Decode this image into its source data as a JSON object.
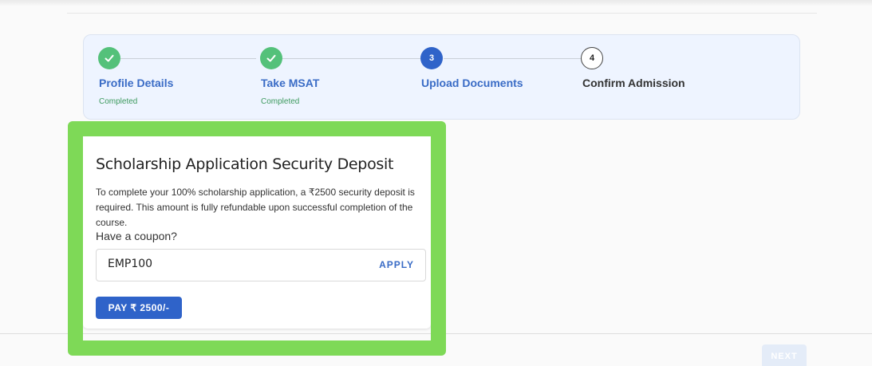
{
  "stepper": {
    "steps": [
      {
        "title": "Profile Details",
        "status": "Completed",
        "state": "done",
        "icon": "check-icon"
      },
      {
        "title": "Take MSAT",
        "status": "Completed",
        "state": "done",
        "icon": "check-icon"
      },
      {
        "title": "Upload Documents",
        "number": "3",
        "state": "active"
      },
      {
        "title": "Confirm Admission",
        "number": "4",
        "state": "todo"
      }
    ]
  },
  "card": {
    "title": "Scholarship Application Security Deposit",
    "description": "To complete your 100% scholarship application, a ₹2500 security deposit is required. This amount is fully refundable upon successful completion of the course.",
    "coupon_label": "Have a coupon?",
    "coupon_value": "EMP100",
    "apply_label": "APPLY",
    "pay_label": "PAY ₹ 2500/-"
  },
  "footer": {
    "next_label": "NEXT"
  },
  "colors": {
    "primary": "#2f63c9",
    "success": "#54c17a",
    "highlight": "#7ed957",
    "stepper_bg": "#eef4ff"
  }
}
